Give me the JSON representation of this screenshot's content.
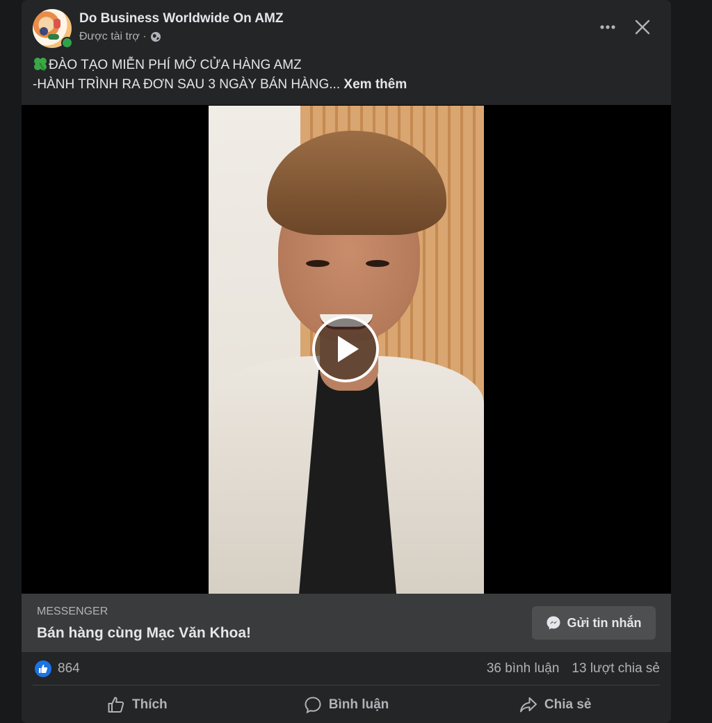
{
  "post": {
    "page_name": "Do Business Worldwide On AMZ",
    "sponsored_label": "Được tài trợ ·",
    "caption": {
      "line1": "ĐÀO TẠO MIỄN PHÍ MỞ CỬA HÀNG AMZ",
      "line2": "-HÀNH TRÌNH RA ĐƠN SAU 3 NGÀY BÁN HÀNG...",
      "see_more": "Xem thêm"
    }
  },
  "cta": {
    "kicker": "MESSENGER",
    "title": "Bán hàng cùng Mạc Văn Khoa!",
    "button_label": "Gửi tin nhắn"
  },
  "stats": {
    "likes": "864",
    "comments": "36 bình luận",
    "shares": "13 lượt chia sẻ"
  },
  "actions": {
    "like": "Thích",
    "comment": "Bình luận",
    "share": "Chia sẻ"
  },
  "colors": {
    "background": "#18191a",
    "card": "#242526",
    "cta_bar": "#3a3b3c",
    "accent_blue": "#1b74e4",
    "online_green": "#31a24c"
  },
  "icons": [
    "globe-icon",
    "more-icon",
    "close-icon",
    "clover-icon",
    "play-icon",
    "messenger-icon",
    "like-icon",
    "comment-icon",
    "share-icon"
  ]
}
